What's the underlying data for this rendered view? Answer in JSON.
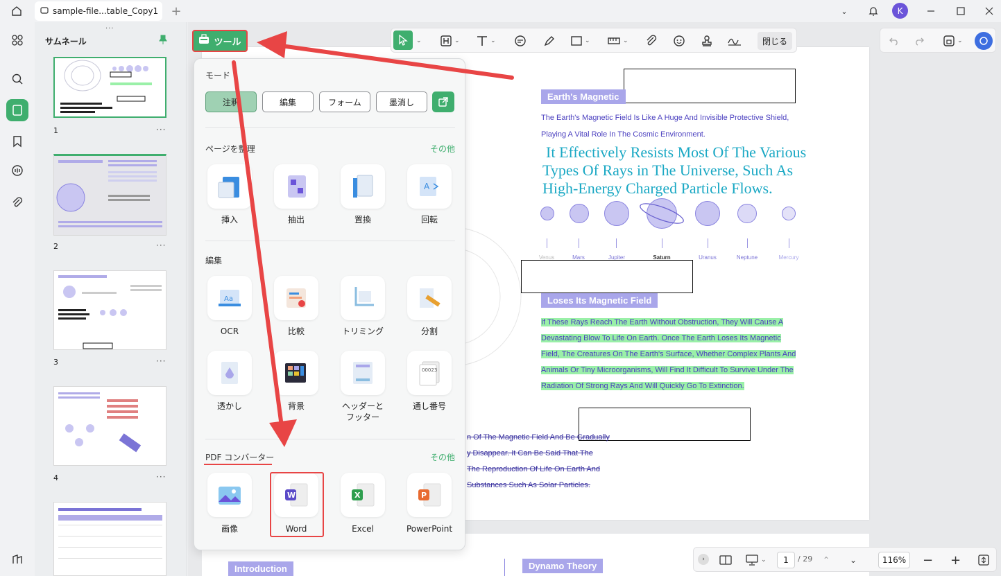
{
  "titlebar": {
    "tab_title": "sample-file...table_Copy1",
    "avatar_letter": "K"
  },
  "sidebar": {
    "title": "サムネール",
    "thumbnails": [
      {
        "number": "1"
      },
      {
        "number": "2"
      },
      {
        "number": "3"
      },
      {
        "number": "4"
      }
    ],
    "more": "···"
  },
  "toolbar": {
    "close_label": "閉じる"
  },
  "tools_button": {
    "label": "ツール"
  },
  "popup": {
    "mode_title": "モード",
    "modes": [
      "注釈",
      "編集",
      "フォーム",
      "墨消し"
    ],
    "organize_title": "ページを整理",
    "more_label": "その他",
    "organize_items": [
      "挿入",
      "抽出",
      "置換",
      "回転"
    ],
    "edit_title": "編集",
    "edit_items_row1": [
      "OCR",
      "比較",
      "トリミング",
      "分割"
    ],
    "edit_items_row2": [
      "透かし",
      "背景",
      "ヘッダーと\nフッター",
      "通し番号"
    ],
    "converter_title": "PDF コンバーター",
    "converter_items": [
      "画像",
      "Word",
      "Excel",
      "PowerPoint"
    ]
  },
  "document": {
    "heading1": "Earth's Magnetic",
    "intro_line1": "The Earth's Magnetic Field Is Like A Huge And Invisible Protective Shield,",
    "intro_line2": "Playing A Vital Role In The Cosmic Environment.",
    "big_line1": "It Effectively Resists Most Of The Various",
    "big_line2": "Types Of Rays in The Universe, Such As",
    "big_line3": "High-Energy Charged Particle Flows.",
    "planets": [
      "Venus",
      "Mars",
      "Jupiter",
      "Saturn",
      "Uranus",
      "Neptune",
      "Mercury"
    ],
    "heading2": "Loses Its Magnetic Field",
    "hl_line1": "If These Rays Reach The Earth Without Obstruction, They Will Cause A",
    "hl_line2": "Devastating Blow To Life On Earth. Once The Earth Loses Its Magnetic",
    "hl_line3": "Field, The Creatures On The Earth's Surface, Whether Complex Plants And",
    "hl_line4": "Animals Or Tiny Microorganisms, Will Find It Difficult To Survive Under The",
    "hl_line5": "Radiation Of Strong Rays And Will Quickly Go To Extinction.",
    "strike_line1": "n Of The Magnetic Field And Be Gradually",
    "strike_line2": "y Disappear. It Can Be Said That The",
    "strike_line3": "The Reproduction Of Life On Earth And",
    "strike_line4": "Substances Such As Solar Particles.",
    "page2_heading1": "Introduction",
    "page2_heading2": "Dynamo Theory"
  },
  "bottombar": {
    "current_page": "1",
    "total_pages": "/ 29",
    "zoom": "116%"
  },
  "colors": {
    "accent": "#3fae6e",
    "highlight_red": "#e84545",
    "heading_bg": "#a9a6ea",
    "cyan_text": "#1aa8c4"
  }
}
